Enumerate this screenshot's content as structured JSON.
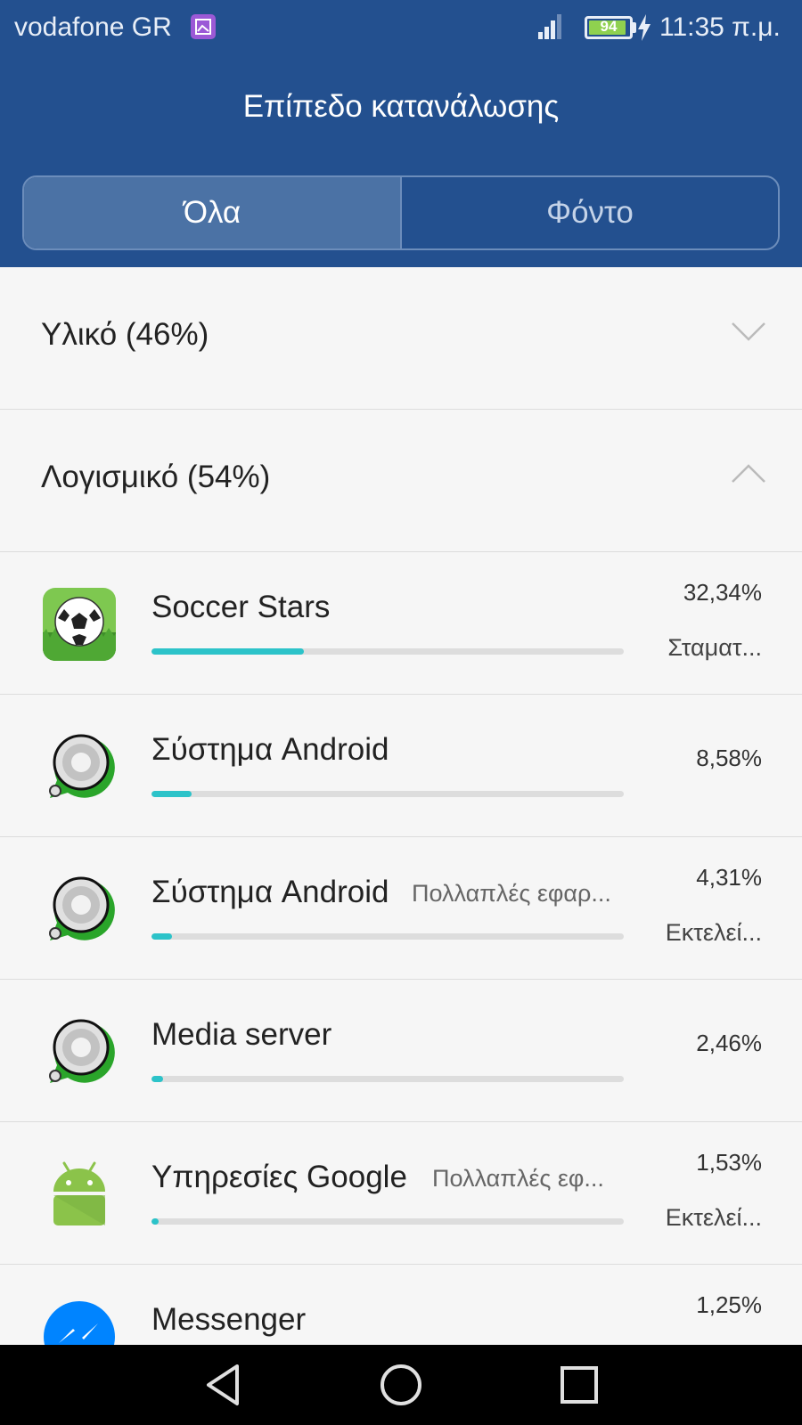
{
  "status_bar": {
    "carrier": "vodafone GR",
    "battery_level": "94",
    "battery_fraction": 0.94,
    "time": "11:35 π.μ.",
    "icons": [
      "gallery-icon",
      "signal-icon",
      "battery-icon",
      "charging-icon"
    ]
  },
  "header": {
    "title": "Επίπεδο κατανάλωσης",
    "background": "#23508f"
  },
  "tabs": [
    {
      "label": "Όλα",
      "selected": true
    },
    {
      "label": "Φόντο",
      "selected": false
    }
  ],
  "sections": {
    "hardware": {
      "label": "Υλικό (46%)",
      "expanded": false,
      "icon": "chevron-down-icon"
    },
    "software": {
      "label": "Λογισμικό (54%)",
      "expanded": true,
      "icon": "chevron-up-icon"
    }
  },
  "apps": [
    {
      "name": "Soccer Stars",
      "sub": "",
      "percent": "32,34%",
      "value": 32.34,
      "status": "Σταματ...",
      "icon": "soccer-stars-icon"
    },
    {
      "name": "Σύστημα Android",
      "sub": "",
      "percent": "8,58%",
      "value": 8.58,
      "status": "",
      "icon": "android-system-icon"
    },
    {
      "name": "Σύστημα Android",
      "sub": "Πολλαπλές εφαρ...",
      "percent": "4,31%",
      "value": 4.31,
      "status": "Εκτελεί...",
      "icon": "android-system-icon"
    },
    {
      "name": "Media server",
      "sub": "",
      "percent": "2,46%",
      "value": 2.46,
      "status": "",
      "icon": "android-system-icon"
    },
    {
      "name": "Υπηρεσίες Google",
      "sub": "Πολλαπλές εφ...",
      "percent": "1,53%",
      "value": 1.53,
      "status": "Εκτελεί...",
      "icon": "android-robot-icon"
    },
    {
      "name": "Messenger",
      "sub": "",
      "percent": "1,25%",
      "value": 1.25,
      "status": "",
      "icon": "messenger-icon"
    }
  ],
  "colors": {
    "accent_bar": "#2cc3c9",
    "bar_track": "#dddddd",
    "nav_bar": "#000000"
  },
  "nav_bar": {
    "buttons": [
      "back-icon",
      "home-icon",
      "recents-icon"
    ]
  }
}
